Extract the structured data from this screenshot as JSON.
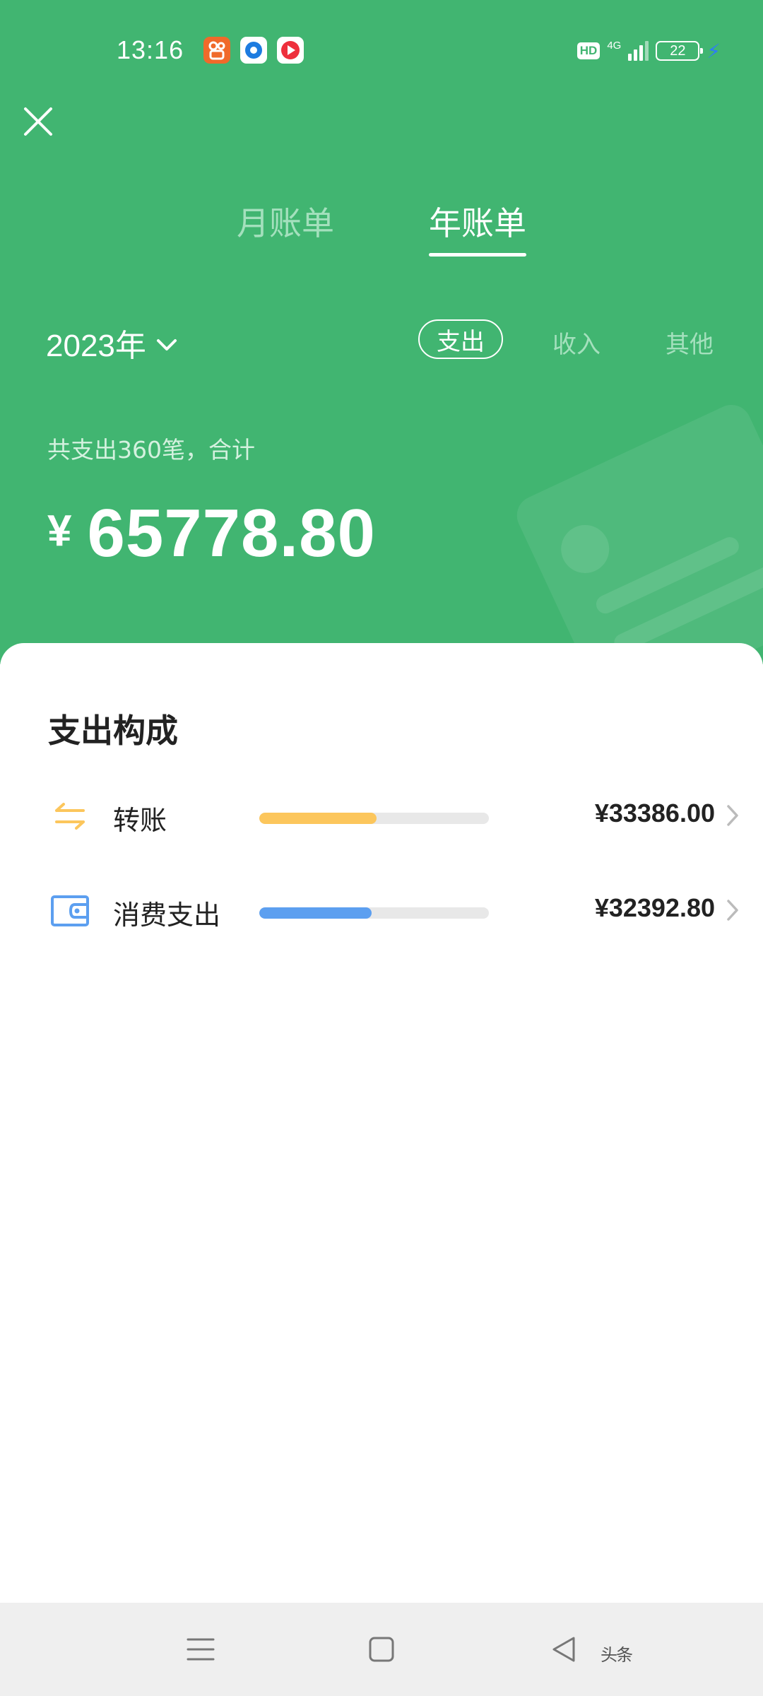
{
  "status_bar": {
    "time": "13:16",
    "hd": "HD",
    "network": "4G",
    "battery": "22",
    "app_icons": [
      "kuaishou-icon",
      "browser-icon",
      "video-icon"
    ]
  },
  "nav": {
    "close_icon": "close-icon"
  },
  "tabs": [
    {
      "label": "月账单",
      "active": false
    },
    {
      "label": "年账单",
      "active": true
    }
  ],
  "filters": {
    "year": "2023年",
    "options": [
      "支出",
      "收入",
      "其他"
    ],
    "selected": "支出"
  },
  "summary": {
    "text": "共支出360笔，合计",
    "currency": "¥",
    "total": "65778.80"
  },
  "breakdown": {
    "title": "支出构成",
    "items": [
      {
        "label": "转账",
        "amount": "¥33386.00",
        "ratio": 0.51,
        "color": "#fcc65c",
        "icon": "transfer-icon"
      },
      {
        "label": "消费支出",
        "amount": "¥32392.80",
        "ratio": 0.49,
        "color": "#5c9ff0",
        "icon": "wallet-icon"
      }
    ]
  },
  "colors": {
    "header_green": "#41b571",
    "inactive_text": "#a4e0bd"
  },
  "bottom_bar": {
    "watermark": "头条"
  }
}
